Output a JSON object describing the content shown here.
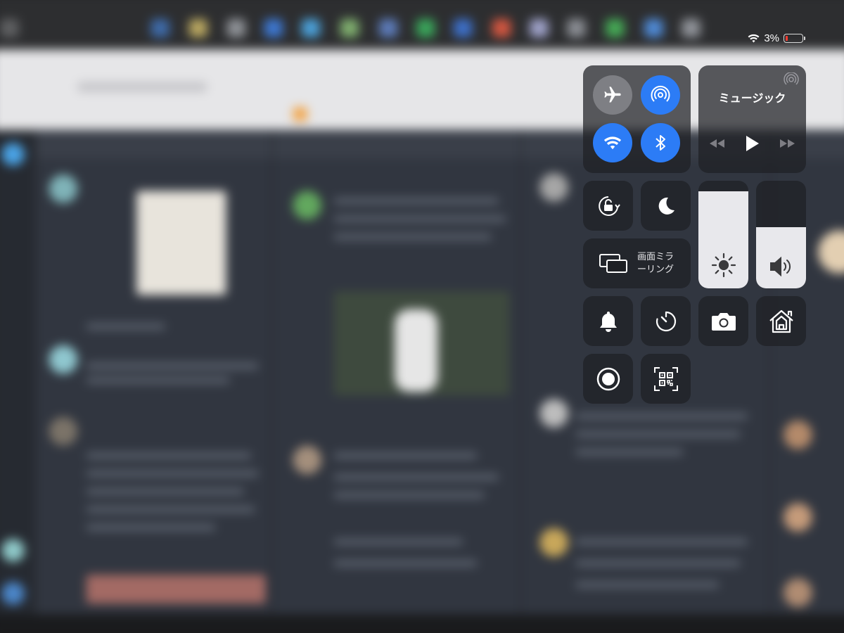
{
  "status_bar": {
    "wifi_icon": "wifi-icon",
    "battery_percent": "3%",
    "battery_level": 0.03,
    "battery_color": "#ff3b30"
  },
  "control_center": {
    "connectivity": {
      "airplane": {
        "icon": "airplane-icon",
        "active": false
      },
      "airdrop": {
        "icon": "airdrop-icon",
        "active": true
      },
      "wifi": {
        "icon": "wifi-icon",
        "active": true
      },
      "bluetooth": {
        "icon": "bluetooth-icon",
        "active": true
      },
      "accent_color": "#2c7cf6"
    },
    "music": {
      "title": "ミュージック",
      "airplay_icon": "airplay-icon",
      "rewind_icon": "rewind-icon",
      "play_icon": "play-icon",
      "forward_icon": "fast-forward-icon"
    },
    "orientation_lock": {
      "icon": "rotation-lock-icon"
    },
    "do_not_disturb": {
      "icon": "moon-icon"
    },
    "screen_mirroring": {
      "label": "画面ミラーリング",
      "icon": "screen-mirroring-icon"
    },
    "brightness": {
      "icon": "sun-icon",
      "level": 0.9
    },
    "volume": {
      "icon": "speaker-icon",
      "level": 0.57
    },
    "shortcuts": [
      {
        "name": "silent-mode",
        "icon": "bell-icon"
      },
      {
        "name": "timer",
        "icon": "timer-icon"
      },
      {
        "name": "camera",
        "icon": "camera-icon"
      },
      {
        "name": "home",
        "icon": "home-icon"
      },
      {
        "name": "screen-recording",
        "icon": "record-icon"
      },
      {
        "name": "qr-scanner",
        "icon": "qr-code-icon"
      }
    ]
  }
}
